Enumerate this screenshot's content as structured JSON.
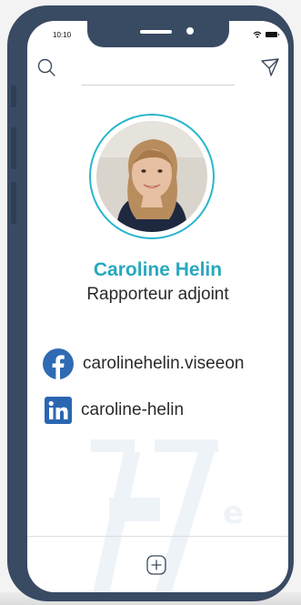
{
  "status_bar": {
    "time": "10:10",
    "icons": [
      "wifi-icon",
      "battery-icon"
    ]
  },
  "header": {
    "left_icon": "search-icon",
    "right_icon": "send-icon"
  },
  "profile": {
    "avatar": "profile-photo",
    "name": "Caroline Helin",
    "role": "Rapporteur adjoint"
  },
  "social": [
    {
      "network": "facebook",
      "icon": "facebook-icon",
      "handle": "carolinehelin.viseeon",
      "color": "#2f6bb3"
    },
    {
      "network": "linkedin",
      "icon": "linkedin-icon",
      "handle": "caroline-helin",
      "color": "#2a66b0"
    }
  ],
  "watermark_letter": "e",
  "footer": {
    "icon": "add-icon"
  },
  "colors": {
    "accent": "#29b6cc",
    "frame": "#394a63",
    "text": "#2a2a2a"
  }
}
